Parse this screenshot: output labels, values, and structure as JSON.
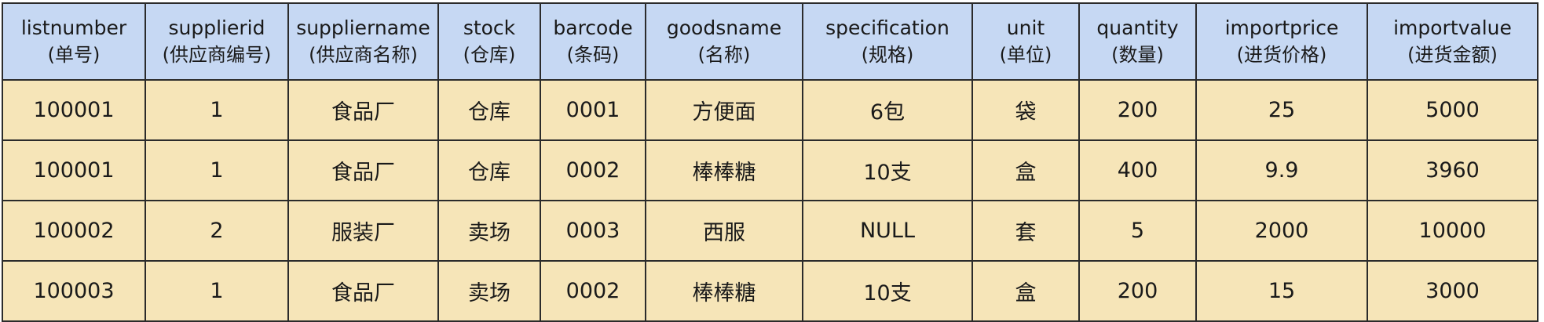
{
  "table": {
    "columns": [
      {
        "en": "listnumber",
        "cn": "(单号)"
      },
      {
        "en": "supplierid",
        "cn": "(供应商编号)"
      },
      {
        "en": "suppliername",
        "cn": "(供应商名称)"
      },
      {
        "en": "stock",
        "cn": "(仓库)"
      },
      {
        "en": "barcode",
        "cn": "(条码)"
      },
      {
        "en": "goodsname",
        "cn": "(名称)"
      },
      {
        "en": "specification",
        "cn": "(规格)"
      },
      {
        "en": "unit",
        "cn": "(单位)"
      },
      {
        "en": "quantity",
        "cn": "(数量)"
      },
      {
        "en": "importprice",
        "cn": "(进货价格)"
      },
      {
        "en": "importvalue",
        "cn": "(进货金额)"
      }
    ],
    "rows": [
      [
        "100001",
        "1",
        "食品厂",
        "仓库",
        "0001",
        "方便面",
        "6包",
        "袋",
        "200",
        "25",
        "5000"
      ],
      [
        "100001",
        "1",
        "食品厂",
        "仓库",
        "0002",
        "棒棒糖",
        "10支",
        "盒",
        "400",
        "9.9",
        "3960"
      ],
      [
        "100002",
        "2",
        "服装厂",
        "卖场",
        "0003",
        "西服",
        "NULL",
        "套",
        "5",
        "2000",
        "10000"
      ],
      [
        "100003",
        "1",
        "食品厂",
        "卖场",
        "0002",
        "棒棒糖",
        "10支",
        "盒",
        "200",
        "15",
        "3000"
      ]
    ]
  },
  "colors": {
    "header_bg": "#c6d8f3",
    "row_bg": "#f6e5b8",
    "border": "#2b2b2b"
  }
}
